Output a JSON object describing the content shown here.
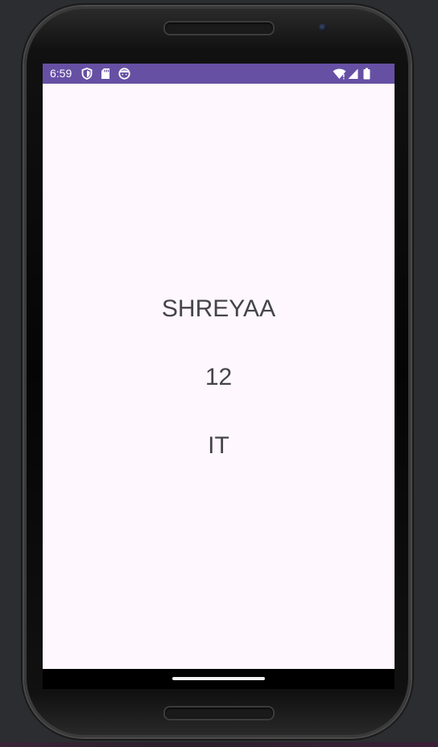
{
  "status_bar": {
    "time": "6:59",
    "background_color": "#6650a4",
    "left_icons": [
      "shield-icon",
      "sd-card-icon",
      "face-icon"
    ],
    "right_icons": [
      "wifi-icon",
      "signal-icon",
      "battery-icon"
    ]
  },
  "app": {
    "background_color": "#fef7fe",
    "name": "SHREYAA",
    "number": "12",
    "department": "IT"
  },
  "navigation": {
    "handle_icon": "gesture-nav-handle"
  }
}
